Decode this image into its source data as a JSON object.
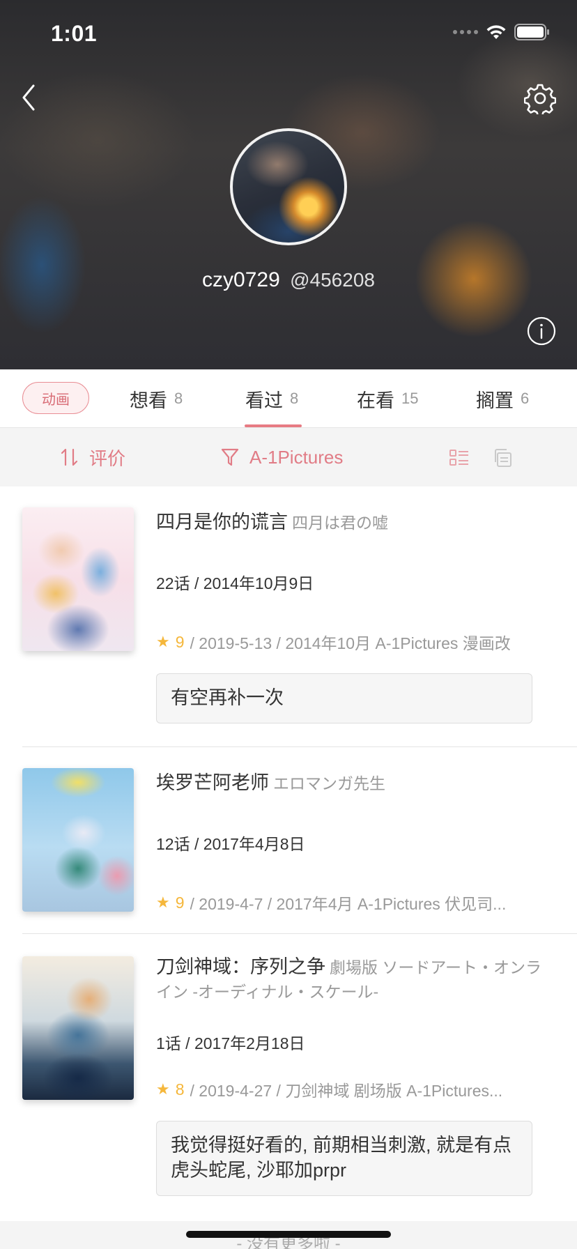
{
  "status_bar": {
    "time": "1:01"
  },
  "header": {
    "username": "czy0729",
    "user_id": "@456208"
  },
  "tabs": {
    "category": "动画",
    "items": [
      {
        "label": "想看",
        "count": "8"
      },
      {
        "label": "看过",
        "count": "8"
      },
      {
        "label": "在看",
        "count": "15"
      },
      {
        "label": "搁置",
        "count": "6"
      }
    ],
    "active_index": 1
  },
  "filter": {
    "sort_label": "评价",
    "filter_label": "A-1Pictures"
  },
  "items": [
    {
      "title": "四月是你的谎言",
      "jp_title": "四月は君の嘘",
      "episodes": "22话 / 2014年10月9日",
      "score": "9",
      "meta": "/ 2019-5-13 / 2014年10月 A-1Pictures 漫画改",
      "comment": "有空再补一次"
    },
    {
      "title": "埃罗芒阿老师",
      "jp_title": "エロマンガ先生",
      "episodes": "12话 / 2017年4月8日",
      "score": "9",
      "meta": "/ 2019-4-7 / 2017年4月 A-1Pictures 伏见司...",
      "comment": ""
    },
    {
      "title": "刀剑神域：序列之争",
      "jp_title": "劇場版 ソードアート・オンライン -オーディナル・スケール-",
      "episodes": "1话 / 2017年2月18日",
      "score": "8",
      "meta": "/ 2019-4-27 / 刀剑神域 剧场版 A-1Pictures...",
      "comment": "我觉得挺好看的, 前期相当刺激, 就是有点虎头蛇尾, 沙耶加prpr"
    }
  ],
  "footer": {
    "no_more": "- 没有更多啦 -"
  },
  "colors": {
    "accent": "#e77b83",
    "star": "#f5b73b"
  }
}
